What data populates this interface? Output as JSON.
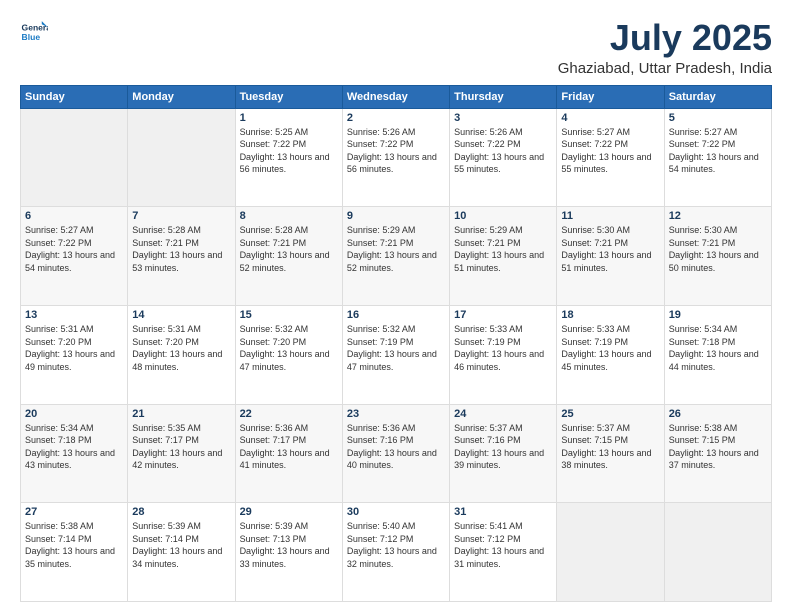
{
  "header": {
    "logo_line1": "General",
    "logo_line2": "Blue",
    "month_year": "July 2025",
    "location": "Ghaziabad, Uttar Pradesh, India"
  },
  "weekdays": [
    "Sunday",
    "Monday",
    "Tuesday",
    "Wednesday",
    "Thursday",
    "Friday",
    "Saturday"
  ],
  "weeks": [
    [
      {
        "day": "",
        "empty": true
      },
      {
        "day": "",
        "empty": true
      },
      {
        "day": "1",
        "sunrise": "5:25 AM",
        "sunset": "7:22 PM",
        "daylight": "13 hours and 56 minutes."
      },
      {
        "day": "2",
        "sunrise": "5:26 AM",
        "sunset": "7:22 PM",
        "daylight": "13 hours and 56 minutes."
      },
      {
        "day": "3",
        "sunrise": "5:26 AM",
        "sunset": "7:22 PM",
        "daylight": "13 hours and 55 minutes."
      },
      {
        "day": "4",
        "sunrise": "5:27 AM",
        "sunset": "7:22 PM",
        "daylight": "13 hours and 55 minutes."
      },
      {
        "day": "5",
        "sunrise": "5:27 AM",
        "sunset": "7:22 PM",
        "daylight": "13 hours and 54 minutes."
      }
    ],
    [
      {
        "day": "6",
        "sunrise": "5:27 AM",
        "sunset": "7:22 PM",
        "daylight": "13 hours and 54 minutes."
      },
      {
        "day": "7",
        "sunrise": "5:28 AM",
        "sunset": "7:21 PM",
        "daylight": "13 hours and 53 minutes."
      },
      {
        "day": "8",
        "sunrise": "5:28 AM",
        "sunset": "7:21 PM",
        "daylight": "13 hours and 52 minutes."
      },
      {
        "day": "9",
        "sunrise": "5:29 AM",
        "sunset": "7:21 PM",
        "daylight": "13 hours and 52 minutes."
      },
      {
        "day": "10",
        "sunrise": "5:29 AM",
        "sunset": "7:21 PM",
        "daylight": "13 hours and 51 minutes."
      },
      {
        "day": "11",
        "sunrise": "5:30 AM",
        "sunset": "7:21 PM",
        "daylight": "13 hours and 51 minutes."
      },
      {
        "day": "12",
        "sunrise": "5:30 AM",
        "sunset": "7:21 PM",
        "daylight": "13 hours and 50 minutes."
      }
    ],
    [
      {
        "day": "13",
        "sunrise": "5:31 AM",
        "sunset": "7:20 PM",
        "daylight": "13 hours and 49 minutes."
      },
      {
        "day": "14",
        "sunrise": "5:31 AM",
        "sunset": "7:20 PM",
        "daylight": "13 hours and 48 minutes."
      },
      {
        "day": "15",
        "sunrise": "5:32 AM",
        "sunset": "7:20 PM",
        "daylight": "13 hours and 47 minutes."
      },
      {
        "day": "16",
        "sunrise": "5:32 AM",
        "sunset": "7:19 PM",
        "daylight": "13 hours and 47 minutes."
      },
      {
        "day": "17",
        "sunrise": "5:33 AM",
        "sunset": "7:19 PM",
        "daylight": "13 hours and 46 minutes."
      },
      {
        "day": "18",
        "sunrise": "5:33 AM",
        "sunset": "7:19 PM",
        "daylight": "13 hours and 45 minutes."
      },
      {
        "day": "19",
        "sunrise": "5:34 AM",
        "sunset": "7:18 PM",
        "daylight": "13 hours and 44 minutes."
      }
    ],
    [
      {
        "day": "20",
        "sunrise": "5:34 AM",
        "sunset": "7:18 PM",
        "daylight": "13 hours and 43 minutes."
      },
      {
        "day": "21",
        "sunrise": "5:35 AM",
        "sunset": "7:17 PM",
        "daylight": "13 hours and 42 minutes."
      },
      {
        "day": "22",
        "sunrise": "5:36 AM",
        "sunset": "7:17 PM",
        "daylight": "13 hours and 41 minutes."
      },
      {
        "day": "23",
        "sunrise": "5:36 AM",
        "sunset": "7:16 PM",
        "daylight": "13 hours and 40 minutes."
      },
      {
        "day": "24",
        "sunrise": "5:37 AM",
        "sunset": "7:16 PM",
        "daylight": "13 hours and 39 minutes."
      },
      {
        "day": "25",
        "sunrise": "5:37 AM",
        "sunset": "7:15 PM",
        "daylight": "13 hours and 38 minutes."
      },
      {
        "day": "26",
        "sunrise": "5:38 AM",
        "sunset": "7:15 PM",
        "daylight": "13 hours and 37 minutes."
      }
    ],
    [
      {
        "day": "27",
        "sunrise": "5:38 AM",
        "sunset": "7:14 PM",
        "daylight": "13 hours and 35 minutes."
      },
      {
        "day": "28",
        "sunrise": "5:39 AM",
        "sunset": "7:14 PM",
        "daylight": "13 hours and 34 minutes."
      },
      {
        "day": "29",
        "sunrise": "5:39 AM",
        "sunset": "7:13 PM",
        "daylight": "13 hours and 33 minutes."
      },
      {
        "day": "30",
        "sunrise": "5:40 AM",
        "sunset": "7:12 PM",
        "daylight": "13 hours and 32 minutes."
      },
      {
        "day": "31",
        "sunrise": "5:41 AM",
        "sunset": "7:12 PM",
        "daylight": "13 hours and 31 minutes."
      },
      {
        "day": "",
        "empty": true
      },
      {
        "day": "",
        "empty": true
      }
    ]
  ],
  "labels": {
    "sunrise": "Sunrise: ",
    "sunset": "Sunset: ",
    "daylight": "Daylight: "
  }
}
